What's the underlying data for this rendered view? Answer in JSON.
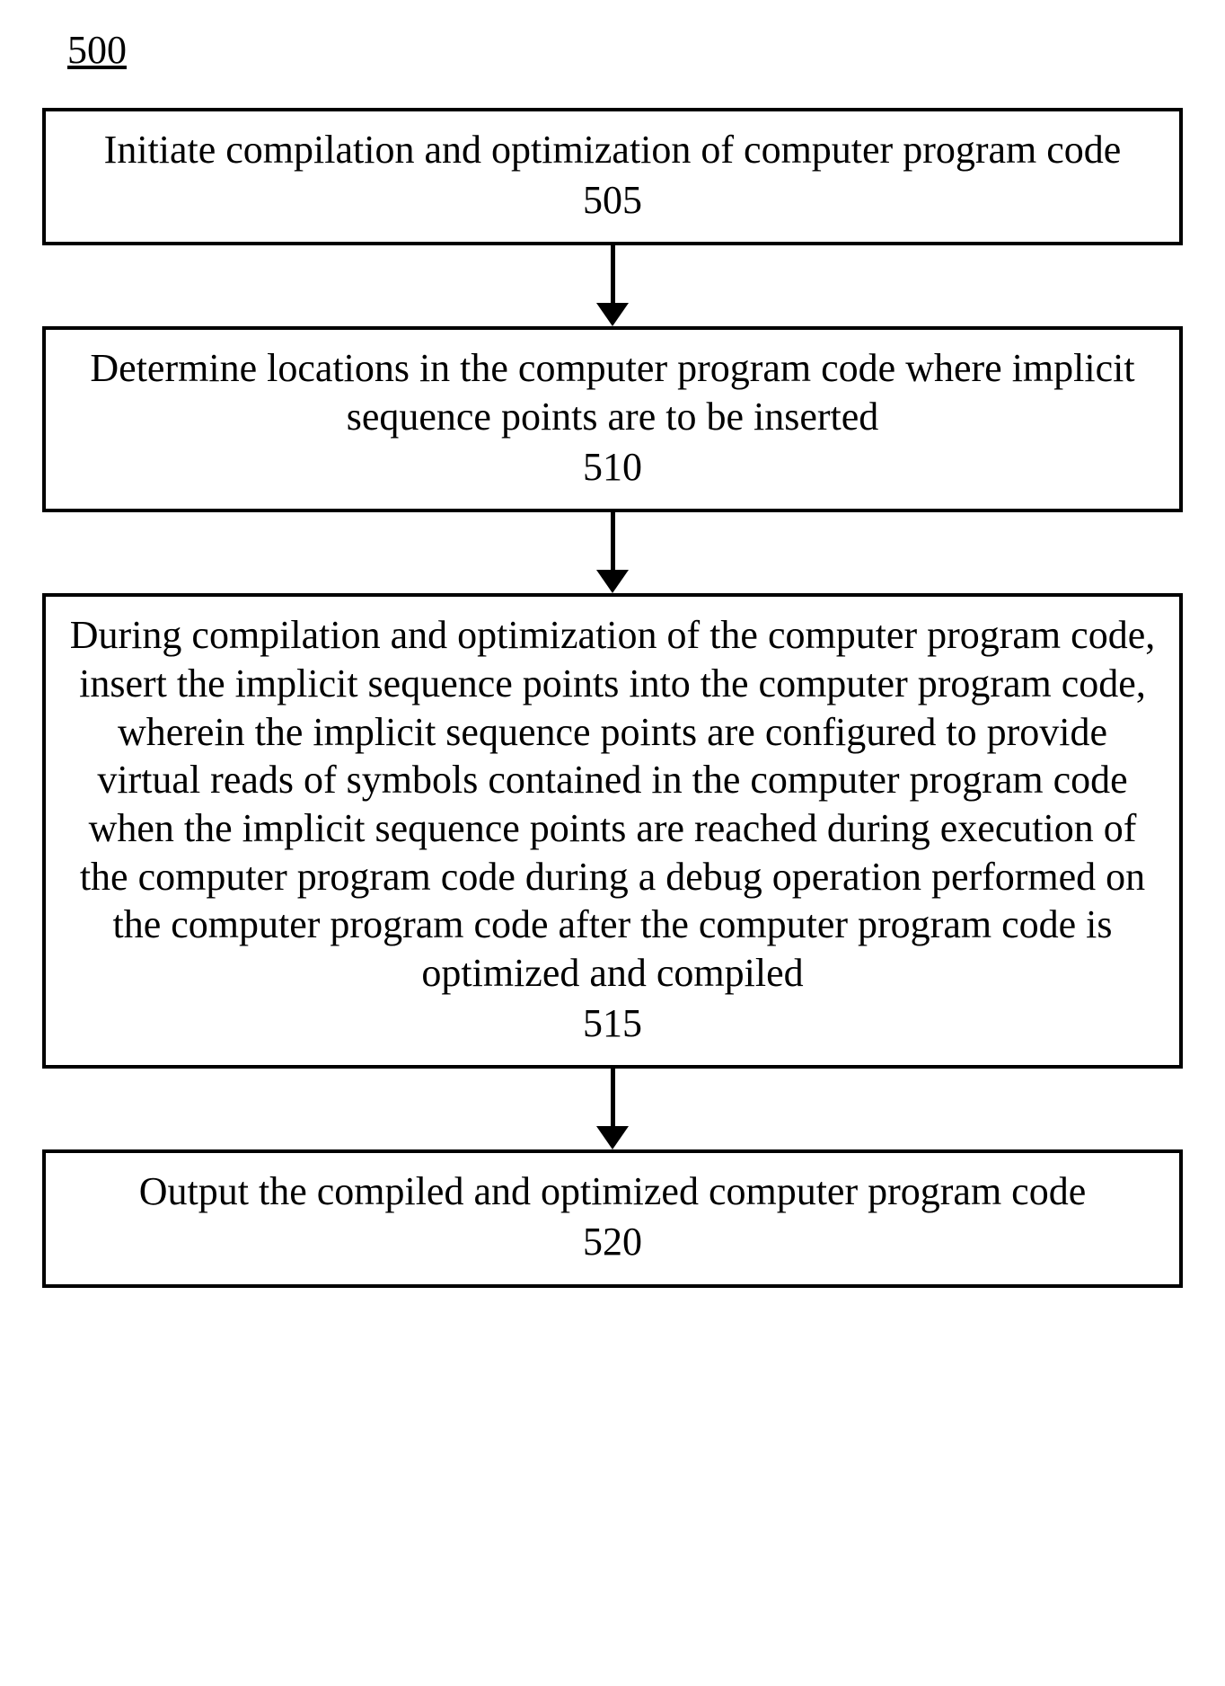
{
  "figure_reference": "500",
  "steps": [
    {
      "text": "Initiate compilation and optimization of computer program code",
      "num": "505"
    },
    {
      "text": "Determine locations in the computer program code where implicit sequence points are to be inserted",
      "num": "510"
    },
    {
      "text": "During compilation and optimization of the computer program code, insert the implicit sequence points into the computer program code, wherein the implicit sequence points are configured to provide virtual reads of symbols contained in the computer program code when the implicit sequence points are reached during execution of the computer program code during a debug operation performed on the computer program code after the computer program code is optimized and compiled",
      "num": "515"
    },
    {
      "text": "Output the compiled and optimized computer program code",
      "num": "520"
    }
  ]
}
